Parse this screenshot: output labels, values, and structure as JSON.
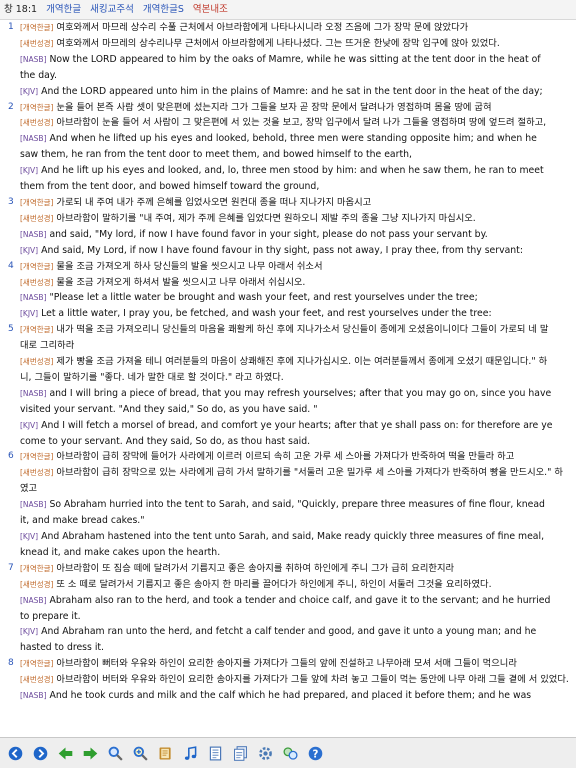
{
  "header": {
    "reference": "창 18:1",
    "tabs": [
      {
        "label": "개역한글"
      },
      {
        "label": "새킹교주석"
      },
      {
        "label": "개역한글S"
      },
      {
        "label": "역본내조"
      }
    ]
  },
  "verses": [
    {
      "number": "1",
      "lines": [
        {
          "tag": "[개역한글]",
          "text": "여호와께서 마므레 상수리 수풀 근처에서 아브라함에게 나타나시니라 오정 즈음에 그가 장막 문에 앉았다가",
          "cont": ""
        },
        {
          "tag": "[새번성경]",
          "text": "여호와께서 마므레의 상수리나무 근처에서 아브라함에게 나타나셨다. 그는 뜨거운 한낮에 장막 입구에 앉아 있었다.",
          "cont": ""
        },
        {
          "tag": "[NASB]",
          "text": "Now the LORD appeared to him by the oaks of Mamre, while he was sitting at the tent door in the heat of",
          "cont": "the day."
        },
        {
          "tag": "[KJV]",
          "text": "And the LORD appeared unto him in the plains of Mamre: and he sat in the tent door in the heat of the day;",
          "cont": ""
        }
      ]
    },
    {
      "number": "2",
      "lines": [
        {
          "tag": "[개역한글]",
          "text": "눈을 들어 본즉 사람 셋이 맞은편에 섰는지라 그가 그들을 보자 곧 장막 문에서 달려나가 영접하며 몸을 땅에 굽혀",
          "cont": ""
        },
        {
          "tag": "[새번성경]",
          "text": "아브라함이 눈을 들어 서 사람이 그 맞은편에 서 있는 것을 보고, 장막 입구에서 달려 나가 그들을 영접하며 땅에 엎드려 절하고,",
          "cont": ""
        },
        {
          "tag": "[NASB]",
          "text": "And when he lifted up his eyes and looked, behold, three men were standing opposite him; and when he",
          "cont": "saw them, he ran from the tent door to meet them, and bowed himself to the earth,"
        },
        {
          "tag": "[KJV]",
          "text": "And he lift up his eyes and looked, and, lo, three men stood by him: and when he saw them, he ran to meet",
          "cont": "them from the tent door, and bowed himself toward the ground,"
        }
      ]
    },
    {
      "number": "3",
      "lines": [
        {
          "tag": "[개역한글]",
          "text": "가로되 내 주여 내가 주께 은혜를 입었사오면 원컨대 종을 떠나 지나가지 마옵시고",
          "cont": ""
        },
        {
          "tag": "[새번성경]",
          "text": "아브라함이 말하기를 \"내 주여, 제가 주께 은혜를 입었다면 원하오니 제발 주의 종을 그냥 지나가지 마십시오.",
          "cont": ""
        },
        {
          "tag": "[NASB]",
          "text": "and said, \"My lord, if now I have found favor in your sight, please do not pass your servant by.",
          "cont": ""
        },
        {
          "tag": "[KJV]",
          "text": "And said, My Lord, if now I have found favour in thy sight, pass not away, I pray thee, from thy servant:",
          "cont": ""
        }
      ]
    },
    {
      "number": "4",
      "lines": [
        {
          "tag": "[개역한글]",
          "text": "물을 조금 가져오게 하사 당신들의 발을 씻으시고 나무 아래서 쉬소서",
          "cont": ""
        },
        {
          "tag": "[새번성경]",
          "text": "물을 조금 가져오게 하셔서 발을 씻으시고 나무 아래서 쉬십시오.",
          "cont": ""
        },
        {
          "tag": "[NASB]",
          "text": "\"Please let a little water be brought and wash your feet, and rest yourselves under the tree;",
          "cont": ""
        },
        {
          "tag": "[KJV]",
          "text": "Let a little water, I pray you, be fetched, and wash your feet, and rest yourselves under the tree:",
          "cont": ""
        }
      ]
    },
    {
      "number": "5",
      "lines": [
        {
          "tag": "[개역한글]",
          "text": "내가 떡을 조금 가져오리니 당신들의 마음을 쾌활케 하신 후에 지나가소서 당신들이 종에게 오셨음이니이다 그들이 가로되 네 말",
          "cont": "대로 그리하라"
        },
        {
          "tag": "[새번성경]",
          "text": "제가 빵을 조금 가져올 테니 여러분들의 마음이 상쾌해진 후에 지나가십시오. 이는 여러분들께서 종에게 오셨기 때문입니다.\" 하",
          "cont": "니, 그들이 말하기를 \"좋다. 네가 말한 대로 할 것이다.\" 라고 하였다."
        },
        {
          "tag": "[NASB]",
          "text": "and I will bring a piece of bread, that you may refresh yourselves; after that you may go on, since you have",
          "cont": "visited your servant. \"And they said,\" So do, as you have said. \""
        },
        {
          "tag": "[KJV]",
          "text": "And I will fetch a morsel of bread, and comfort ye your hearts; after that ye shall pass on: for therefore are ye",
          "cont": "come to your servant. And they said, So do, as thou hast said."
        }
      ]
    },
    {
      "number": "6",
      "lines": [
        {
          "tag": "[개역한글]",
          "text": "아브라함이 급히 장막에 들어가 사라에게 이르러 이르되 속히 고운 가루 세 스아를 가져다가 반죽하여 떡을 만들라 하고",
          "cont": ""
        },
        {
          "tag": "[새번성경]",
          "text": "아브라함이 급히 장막으로 있는 사라에게 급히 가서 말하기를 \"서둘러 고운 밀가루 세 스아를 가져다가 반죽하여 빵을 만드시오.\" 하였고",
          "cont": ""
        },
        {
          "tag": "[NASB]",
          "text": "So Abraham hurried into the tent to Sarah, and said, \"Quickly, prepare three measures of fine flour, knead",
          "cont": "it, and make bread cakes.\""
        },
        {
          "tag": "[KJV]",
          "text": "And Abraham hastened into the tent unto Sarah, and said, Make ready quickly three measures of fine meal,",
          "cont": "knead it, and make cakes upon the hearth."
        }
      ]
    },
    {
      "number": "7",
      "lines": [
        {
          "tag": "[개역한글]",
          "text": "아브라함이 또 짐승 떼에 달려가서 기름지고 좋은 송아지를 취하여 하인에게 주니 그가 급히 요리한지라",
          "cont": ""
        },
        {
          "tag": "[새번성경]",
          "text": "또 소 떼로 달려가서 기름지고 좋은 송아지 한 마리를 끌어다가 하인에게 주니, 하인이 서둘러 그것을 요리하였다.",
          "cont": ""
        },
        {
          "tag": "[NASB]",
          "text": "Abraham also ran to the herd, and took a tender and choice calf, and gave it to the servant; and he hurried",
          "cont": "to prepare it."
        },
        {
          "tag": "[KJV]",
          "text": "And Abraham ran unto the herd, and fetcht a calf tender and good, and gave it unto a young man; and he",
          "cont": "hasted to dress it."
        }
      ]
    },
    {
      "number": "8",
      "lines": [
        {
          "tag": "[개역한글]",
          "text": "아브라함이 뻐터와 우유와 하인이 요리한 송아지를 가져다가 그들의 앞에 진설하고 나무아래 모셔 서매 그들이 먹으니라",
          "cont": ""
        },
        {
          "tag": "[새번성경]",
          "text": "아브라함이 버터와 우유와 하인이 요리한 송아지를 가져다가 그들 앞에 차려 놓고 그들이 먹는 동안에 나무 아래 그들 곁에 서 있었다.",
          "cont": ""
        },
        {
          "tag": "[NASB]",
          "text": "And he took curds and milk and the calf which he had prepared, and placed it before them; and he was",
          "cont": ""
        }
      ]
    }
  ],
  "toolbar": {
    "buttons": [
      {
        "icon": "back-icon",
        "color": "#1f66c9"
      },
      {
        "icon": "forward-icon",
        "color": "#1f66c9"
      },
      {
        "icon": "prev-icon",
        "color": "#2e9e2e"
      },
      {
        "icon": "next-icon",
        "color": "#2e9e2e"
      },
      {
        "icon": "search-icon",
        "color": "#2a6fd0"
      },
      {
        "icon": "zoom-icon",
        "color": "#2a6fd0"
      },
      {
        "icon": "book-icon",
        "color": "#c28a2b"
      },
      {
        "icon": "music-icon",
        "color": "#1f66c9"
      },
      {
        "icon": "document-icon",
        "color": "#4b78b8"
      },
      {
        "icon": "pages-icon",
        "color": "#4b78b8"
      },
      {
        "icon": "settings-icon",
        "color": "#4a7ab5"
      },
      {
        "icon": "link-icon",
        "color": "#3a9b3a"
      },
      {
        "icon": "help-icon",
        "color": "#2a6fd0"
      }
    ]
  }
}
